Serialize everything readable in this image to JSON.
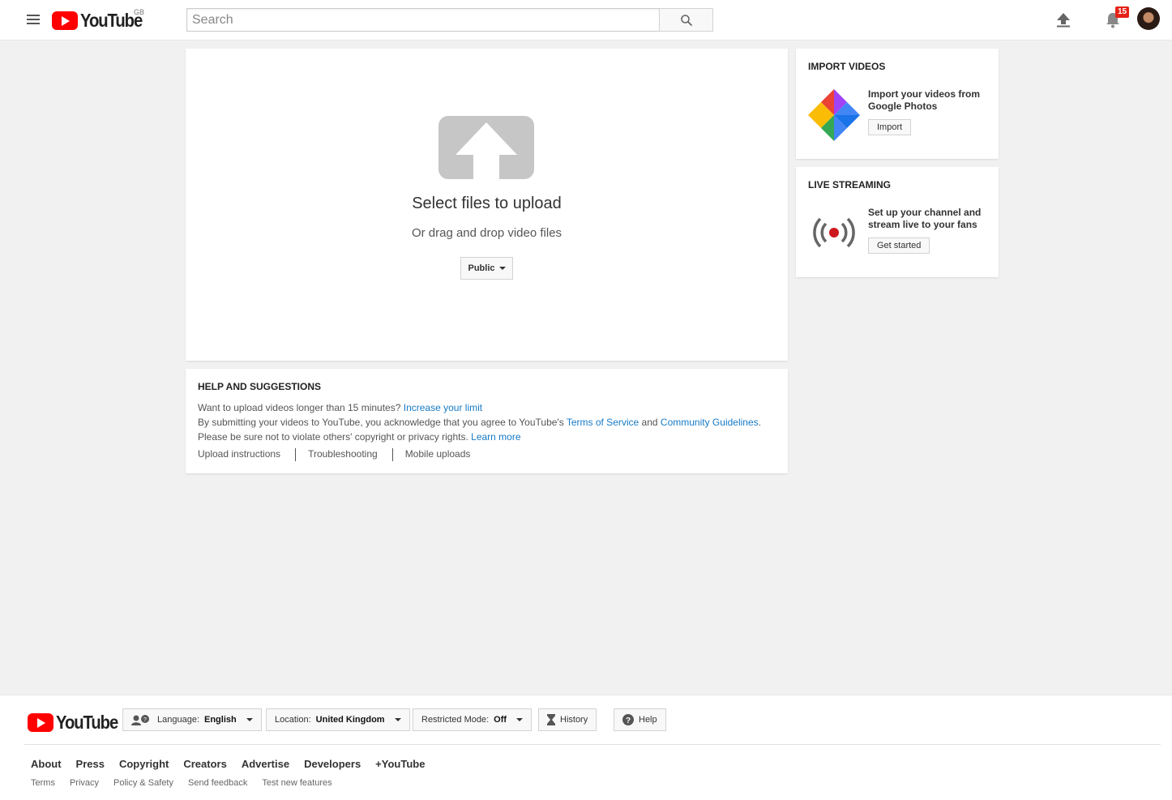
{
  "masthead": {
    "logo_text": "YouTube",
    "country_code": "GB",
    "search_placeholder": "Search",
    "notification_count": "15",
    "icons": [
      "menu-icon",
      "search-icon",
      "upload-icon",
      "bell-icon"
    ]
  },
  "upload": {
    "title": "Select files to upload",
    "subtitle": "Or drag and drop video files",
    "privacy_value": "Public"
  },
  "help": {
    "heading": "HELP AND SUGGESTIONS",
    "line1_text": "Want to upload videos longer than 15 minutes?",
    "line1_link": "Increase your limit",
    "line2_text_a": "By submitting your videos to YouTube, you acknowledge that you agree to YouTube's",
    "line2_link_a": "Terms of Service",
    "line2_text_b": "and",
    "line2_link_b": "Community Guidelines",
    "line2_text_c": ".",
    "line3_text": "Please be sure not to violate others' copyright or privacy rights.",
    "line3_link": "Learn more",
    "links": [
      "Upload instructions",
      "Troubleshooting",
      "Mobile uploads"
    ]
  },
  "import_card": {
    "heading": "IMPORT VIDEOS",
    "text": "Import your videos from Google Photos",
    "button": "Import"
  },
  "stream_card": {
    "heading": "LIVE STREAMING",
    "text": "Set up your channel and stream live to your fans",
    "button": "Get started"
  },
  "footer": {
    "logo_text": "YouTube",
    "language_label": "Language:",
    "language_value": "English",
    "location_label": "Location:",
    "location_value": "United Kingdom",
    "restricted_label": "Restricted Mode:",
    "restricted_value": "Off",
    "history": "History",
    "help": "Help",
    "primary_links": [
      "About",
      "Press",
      "Copyright",
      "Creators",
      "Advertise",
      "Developers",
      "+YouTube"
    ],
    "secondary_links": [
      "Terms",
      "Privacy",
      "Policy & Safety",
      "Send feedback",
      "Test new features"
    ]
  },
  "colors": {
    "brand_red": "#ff0000",
    "link_blue": "#167ac6",
    "badge_red": "#e62117",
    "background": "#f1f1f1"
  }
}
